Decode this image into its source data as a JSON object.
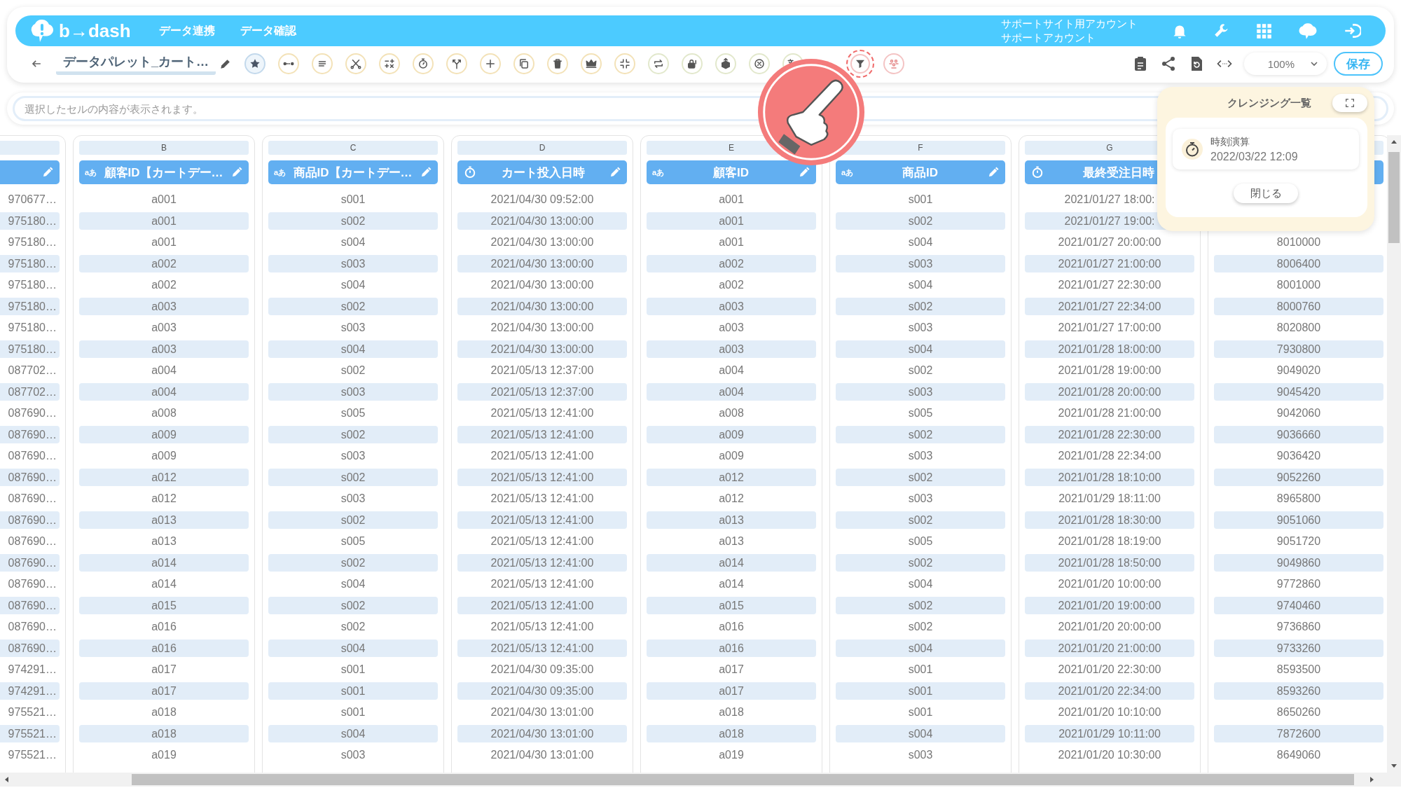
{
  "app": {
    "logo": "b→dash",
    "nav": [
      {
        "label": "データ連携"
      },
      {
        "label": "データ確認"
      }
    ],
    "account": {
      "site": "サポートサイト用アカウント",
      "name": "サポートアカウント"
    }
  },
  "toolbar": {
    "title": "データパレット_カート…",
    "tools": [
      {
        "selected": true,
        "color": "#c3d9ec",
        "highlighted": false
      },
      {
        "selected": false,
        "color": "#f3e2b8",
        "highlighted": false
      },
      {
        "selected": false,
        "color": "#f3e2b8",
        "highlighted": false
      },
      {
        "selected": false,
        "color": "#f3e2b8",
        "highlighted": false
      },
      {
        "selected": false,
        "color": "#f3e2b8",
        "highlighted": false
      },
      {
        "selected": false,
        "color": "#f3e2b8",
        "highlighted": false
      },
      {
        "selected": false,
        "color": "#f3e2b8",
        "highlighted": false
      },
      {
        "selected": false,
        "color": "#f3e2b8",
        "highlighted": false
      },
      {
        "selected": false,
        "color": "#f3e2b8",
        "highlighted": false
      },
      {
        "selected": false,
        "color": "#f3e2b8",
        "highlighted": false
      },
      {
        "selected": false,
        "color": "#f3e2b8",
        "highlighted": false
      },
      {
        "selected": false,
        "color": "#f3e2b8",
        "highlighted": false
      },
      {
        "selected": false,
        "color": "#e2e8cc",
        "highlighted": false
      },
      {
        "selected": false,
        "color": "#e2e8cc",
        "highlighted": false
      },
      {
        "selected": false,
        "color": "#e2e8cc",
        "highlighted": false
      },
      {
        "selected": false,
        "color": "#e2e8cc",
        "highlighted": false
      },
      {
        "selected": false,
        "color": "#e2e8cc",
        "highlighted": false
      },
      {
        "selected": false,
        "color": "#f4c4c4",
        "highlighted": true
      },
      {
        "selected": false,
        "color": "#f4c4c4",
        "highlighted": false
      }
    ],
    "zoom": "100%",
    "save": "保存"
  },
  "cell_viewer": {
    "placeholder": "選択したセルの内容が表示されます。"
  },
  "columns": [
    {
      "editable": true,
      "values": [
        "970677…",
        "975180…",
        "975180…",
        "975180…",
        "975180…",
        "975180…",
        "975180…",
        "975180…",
        "087702…",
        "087702…",
        "087690…",
        "087690…",
        "087690…",
        "087690…",
        "087690…",
        "087690…",
        "087690…",
        "087690…",
        "087690…",
        "087690…",
        "087690…",
        "087690…",
        "974291…",
        "974291…",
        "975521…",
        "975521…",
        "975521…"
      ]
    },
    {
      "letter": "B",
      "kind": "text",
      "badge": "aあ",
      "title": "顧客ID【カートデー…",
      "editable": true,
      "values": [
        "a001",
        "a001",
        "a001",
        "a002",
        "a002",
        "a003",
        "a003",
        "a003",
        "a004",
        "a004",
        "a008",
        "a009",
        "a009",
        "a012",
        "a012",
        "a013",
        "a013",
        "a014",
        "a014",
        "a015",
        "a016",
        "a016",
        "a017",
        "a017",
        "a018",
        "a018",
        "a019"
      ]
    },
    {
      "letter": "C",
      "kind": "text",
      "badge": "aあ",
      "title": "商品ID【カートデー…",
      "editable": true,
      "values": [
        "s001",
        "s002",
        "s004",
        "s003",
        "s004",
        "s002",
        "s003",
        "s004",
        "s002",
        "s003",
        "s005",
        "s002",
        "s003",
        "s002",
        "s003",
        "s002",
        "s005",
        "s002",
        "s004",
        "s002",
        "s002",
        "s004",
        "s001",
        "s001",
        "s001",
        "s004",
        "s003"
      ]
    },
    {
      "letter": "D",
      "kind": "time",
      "title": "カート投入日時",
      "editable": true,
      "values": [
        "2021/04/30 09:52:00",
        "2021/04/30 13:00:00",
        "2021/04/30 13:00:00",
        "2021/04/30 13:00:00",
        "2021/04/30 13:00:00",
        "2021/04/30 13:00:00",
        "2021/04/30 13:00:00",
        "2021/04/30 13:00:00",
        "2021/05/13 12:37:00",
        "2021/05/13 12:37:00",
        "2021/05/13 12:41:00",
        "2021/05/13 12:41:00",
        "2021/05/13 12:41:00",
        "2021/05/13 12:41:00",
        "2021/05/13 12:41:00",
        "2021/05/13 12:41:00",
        "2021/05/13 12:41:00",
        "2021/05/13 12:41:00",
        "2021/05/13 12:41:00",
        "2021/05/13 12:41:00",
        "2021/05/13 12:41:00",
        "2021/05/13 12:41:00",
        "2021/04/30 09:35:00",
        "2021/04/30 09:35:00",
        "2021/04/30 13:01:00",
        "2021/04/30 13:01:00",
        "2021/04/30 13:01:00"
      ]
    },
    {
      "letter": "E",
      "kind": "text",
      "badge": "aあ",
      "title": "顧客ID",
      "editable": true,
      "values": [
        "a001",
        "a001",
        "a001",
        "a002",
        "a002",
        "a003",
        "a003",
        "a003",
        "a004",
        "a004",
        "a008",
        "a009",
        "a009",
        "a012",
        "a012",
        "a013",
        "a013",
        "a014",
        "a014",
        "a015",
        "a016",
        "a016",
        "a017",
        "a017",
        "a018",
        "a018",
        "a019"
      ]
    },
    {
      "letter": "F",
      "kind": "text",
      "badge": "aあ",
      "title": "商品ID",
      "editable": true,
      "values": [
        "s001",
        "s002",
        "s004",
        "s003",
        "s004",
        "s002",
        "s003",
        "s004",
        "s002",
        "s003",
        "s005",
        "s002",
        "s003",
        "s002",
        "s003",
        "s002",
        "s005",
        "s002",
        "s004",
        "s002",
        "s002",
        "s004",
        "s001",
        "s001",
        "s001",
        "s004",
        "s003"
      ]
    },
    {
      "letter": "G",
      "kind": "time",
      "title": "最終受注日時",
      "editable": false,
      "values": [
        "2021/01/27 18:00:",
        "2021/01/27 19:00:",
        "2021/01/27 20:00:00",
        "2021/01/27 21:00:00",
        "2021/01/27 22:30:00",
        "2021/01/27 22:34:00",
        "2021/01/27 17:00:00",
        "2021/01/28 18:00:00",
        "2021/01/28 19:00:00",
        "2021/01/28 20:00:00",
        "2021/01/28 21:00:00",
        "2021/01/28 22:30:00",
        "2021/01/28 22:34:00",
        "2021/01/28 18:10:00",
        "2021/01/29 18:11:00",
        "2021/01/28 18:30:00",
        "2021/01/28 18:19:00",
        "2021/01/28 18:50:00",
        "2021/01/20 10:00:00",
        "2021/01/20 19:00:00",
        "2021/01/20 20:00:00",
        "2021/01/20 21:00:00",
        "2021/01/20 22:30:00",
        "2021/01/20 22:34:00",
        "2021/01/20 10:10:00",
        "2021/01/29 10:11:00",
        "2021/01/20 10:30:00"
      ]
    },
    {
      "editable": false,
      "values": [
        "8010000",
        "8006400",
        "8001000",
        "8000760",
        "8020800",
        "7930800",
        "9049020",
        "9045420",
        "9042060",
        "9036660",
        "9036420",
        "9052260",
        "8965800",
        "9051060",
        "9051720",
        "9049860",
        "9772860",
        "9740460",
        "9736860",
        "9733260",
        "8593500",
        "8593260",
        "8650260",
        "7872600",
        "8649060"
      ]
    }
  ],
  "popup": {
    "title": "クレンジング一覧",
    "items": [
      {
        "name": "時刻演算",
        "time": "2022/03/22 12:09"
      }
    ],
    "close": "閉じる"
  }
}
